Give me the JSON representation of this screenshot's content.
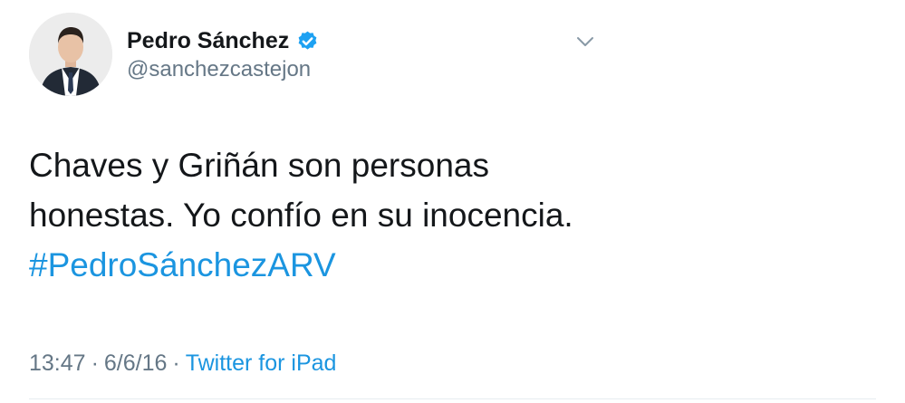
{
  "user": {
    "display_name": "Pedro Sánchez",
    "handle": "@sanchezcastejon",
    "verified_icon": "verified-badge-icon"
  },
  "tweet": {
    "lines": [
      "Chaves y Griñán son personas",
      "honestas. Yo confío en su inocencia."
    ],
    "hashtag": "#PedroSánchezARV"
  },
  "meta": {
    "time": "13:47",
    "separator": "·",
    "date": "6/6/16",
    "source": "Twitter for iPad"
  },
  "colors": {
    "link": "#1b95e0",
    "secondary_text": "#657786",
    "primary_text": "#14171a",
    "divider": "#e6ecf0"
  },
  "icons": {
    "menu": "chevron-down-icon"
  }
}
